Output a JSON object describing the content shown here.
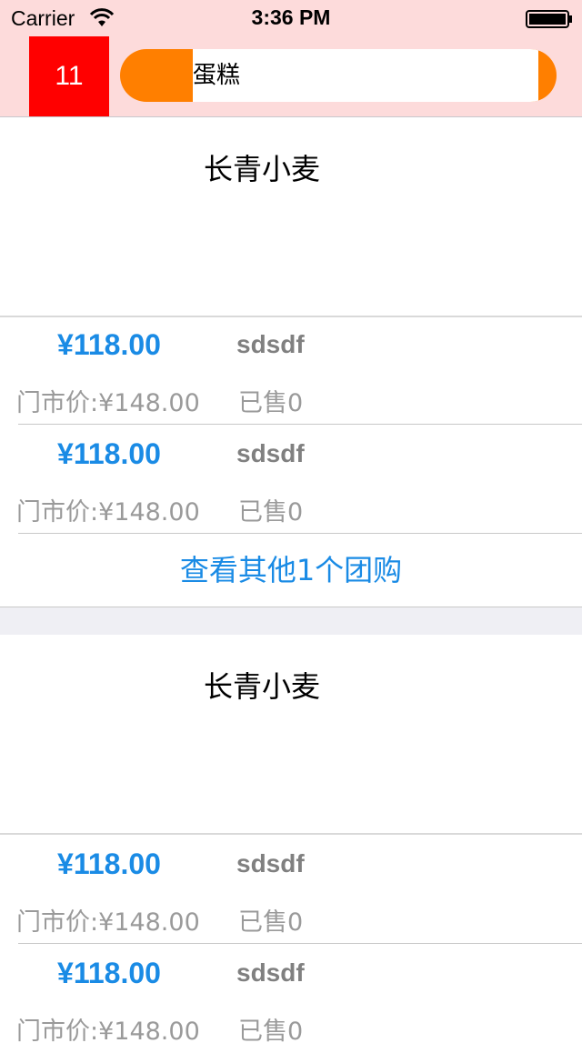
{
  "status_bar": {
    "carrier": "Carrier",
    "time": "3:36 PM"
  },
  "nav": {
    "badge": "11",
    "search_text": "蛋糕",
    "accent_color": "#ff7f00",
    "badge_color": "#ff0000"
  },
  "sections": [
    {
      "store_name": "长青小麦",
      "deals": [
        {
          "price": "¥118.00",
          "title": "sdsdf",
          "original_price": "门市价:¥148.00",
          "sold": "已售0"
        },
        {
          "price": "¥118.00",
          "title": "sdsdf",
          "original_price": "门市价:¥148.00",
          "sold": "已售0"
        }
      ],
      "more_label": "查看其他1个团购"
    },
    {
      "store_name": "长青小麦",
      "deals": [
        {
          "price": "¥118.00",
          "title": "sdsdf",
          "original_price": "门市价:¥148.00",
          "sold": "已售0"
        },
        {
          "price": "¥118.00",
          "title": "sdsdf",
          "original_price": "门市价:¥148.00",
          "sold": "已售0"
        }
      ]
    }
  ]
}
